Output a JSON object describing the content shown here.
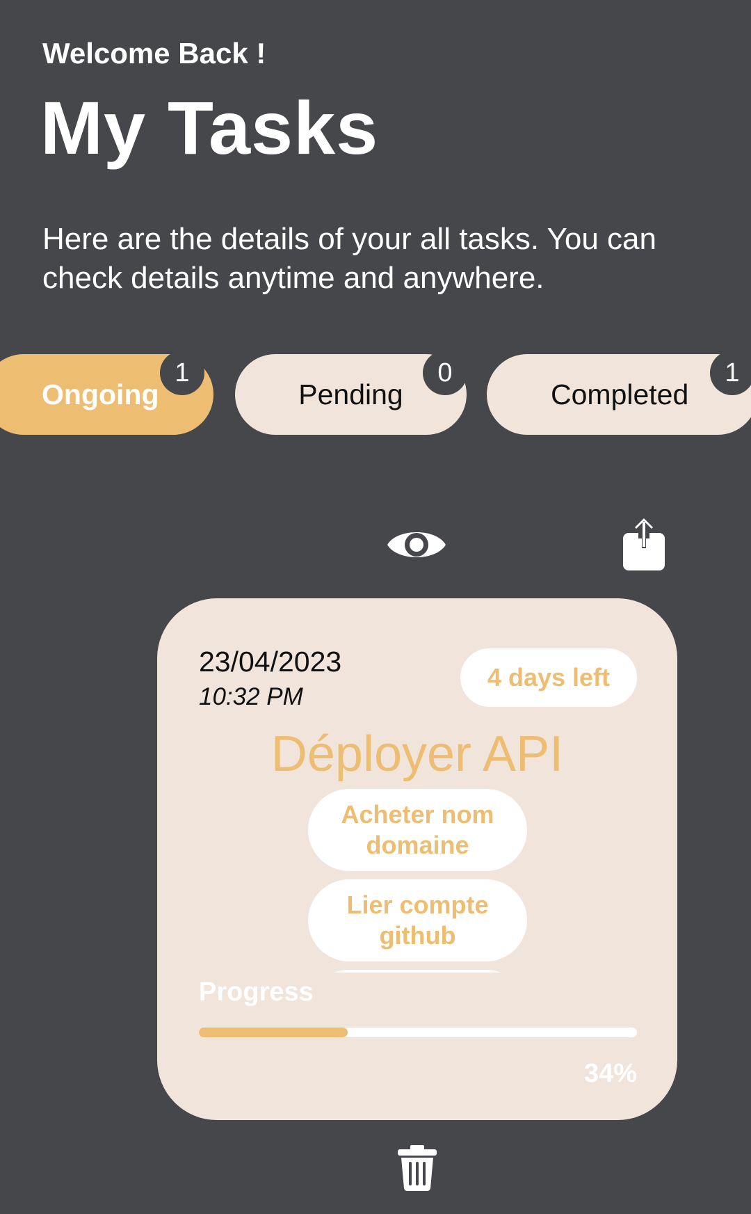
{
  "header": {
    "welcome": "Welcome Back !",
    "title": "My Tasks",
    "subtitle": "Here are the details of your all tasks. You can check details anytime and anywhere."
  },
  "tabs": [
    {
      "label": "Ongoing",
      "count": "1",
      "active": true
    },
    {
      "label": "Pending",
      "count": "0",
      "active": false
    },
    {
      "label": "Completed",
      "count": "1",
      "active": false
    }
  ],
  "actions": {
    "view_icon": "eye-icon",
    "share_icon": "share-icon",
    "delete_icon": "trash-icon"
  },
  "task": {
    "date": "23/04/2023",
    "time": "10:32 PM",
    "days_left": "4 days left",
    "name": "Déployer API",
    "subtasks": [
      "Acheter nom domaine",
      "Lier compte github"
    ],
    "progress_label": "Progress",
    "progress": 0.34,
    "progress_text": "34%"
  },
  "colors": {
    "background": "#46474a",
    "accent": "#edbd71",
    "card": "#f1e4db",
    "tab_inactive": "#f1e4da",
    "white": "#ffffff"
  }
}
